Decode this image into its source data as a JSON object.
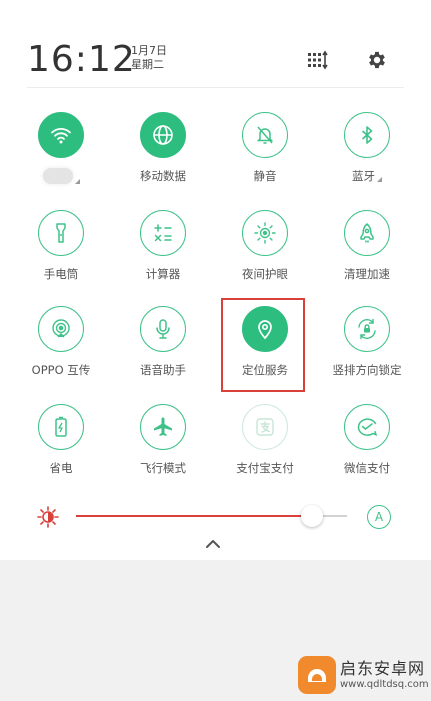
{
  "header": {
    "time": "16:12",
    "date": "1月7日",
    "weekday": "星期二",
    "edit_icon": "grid-sort-icon",
    "settings_icon": "gear-icon"
  },
  "tiles": [
    {
      "label": "",
      "icon": "wifi-icon",
      "state": "on"
    },
    {
      "label": "移动数据",
      "icon": "globe-icon",
      "state": "on"
    },
    {
      "label": "静音",
      "icon": "bell-mute-icon",
      "state": "off"
    },
    {
      "label": "蓝牙",
      "icon": "bluetooth-icon",
      "state": "off"
    },
    {
      "label": "手电筒",
      "icon": "flashlight-icon",
      "state": "off"
    },
    {
      "label": "计算器",
      "icon": "calculator-icon",
      "state": "off"
    },
    {
      "label": "夜间护眼",
      "icon": "eye-sun-icon",
      "state": "off"
    },
    {
      "label": "清理加速",
      "icon": "rocket-icon",
      "state": "off"
    },
    {
      "label": "OPPO 互传",
      "icon": "share-transfer-icon",
      "state": "off"
    },
    {
      "label": "语音助手",
      "icon": "microphone-icon",
      "state": "off"
    },
    {
      "label": "定位服务",
      "icon": "location-pin-icon",
      "state": "on"
    },
    {
      "label": "竖排方向锁定",
      "icon": "rotation-lock-icon",
      "state": "off"
    },
    {
      "label": "省电",
      "icon": "battery-saver-icon",
      "state": "off"
    },
    {
      "label": "飞行模式",
      "icon": "airplane-icon",
      "state": "off"
    },
    {
      "label": "支付宝支付",
      "icon": "alipay-icon",
      "state": "disabled"
    },
    {
      "label": "微信支付",
      "icon": "wechat-pay-icon",
      "state": "off"
    }
  ],
  "brightness": {
    "level": 0.87,
    "auto_label": "A",
    "icon": "brightness-sun-icon"
  },
  "colors": {
    "accent_green": "#2dbd7f",
    "highlight_red": "#d9403a"
  },
  "watermark": {
    "title": "启东安卓网",
    "url": "www.qdltdsq.com"
  }
}
